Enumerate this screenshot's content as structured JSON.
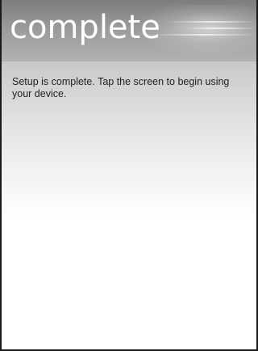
{
  "header": {
    "title": "complete"
  },
  "main": {
    "message": "Setup is complete. Tap the screen to begin using your device."
  }
}
